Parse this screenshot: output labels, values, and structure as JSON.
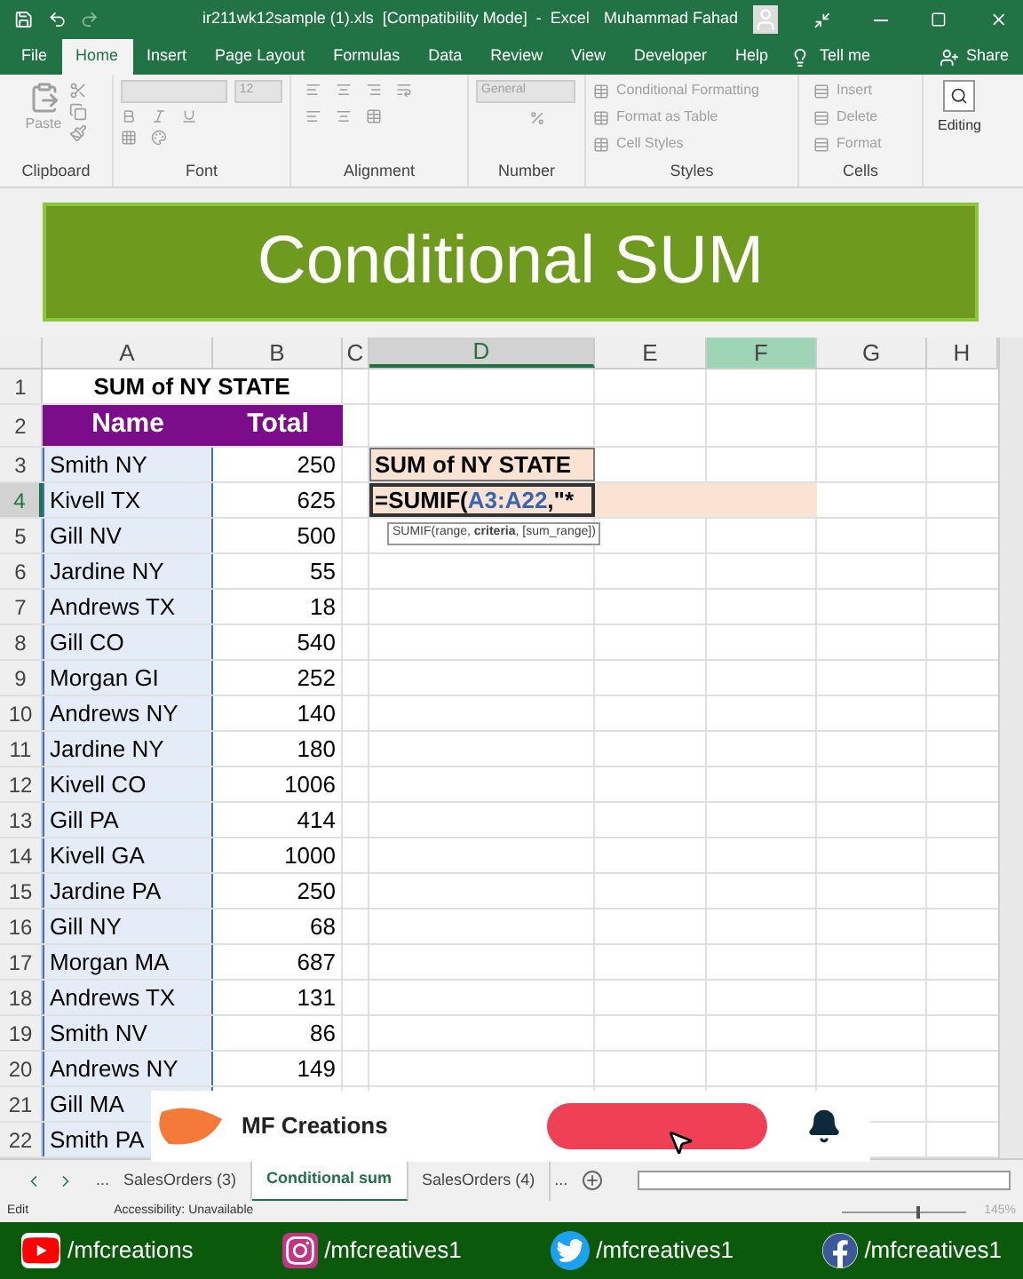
{
  "title_bar": {
    "file_title": "ir211wk12sample (1).xls  [Compatibility Mode]  -  Excel",
    "user_name": "Muhammad Fahad"
  },
  "menu_tabs": [
    {
      "label": "File",
      "selected": false
    },
    {
      "label": "Home",
      "selected": true
    },
    {
      "label": "Insert",
      "selected": false
    },
    {
      "label": "Page Layout",
      "selected": false
    },
    {
      "label": "Formulas",
      "selected": false
    },
    {
      "label": "Data",
      "selected": false
    },
    {
      "label": "Review",
      "selected": false
    },
    {
      "label": "View",
      "selected": false
    },
    {
      "label": "Developer",
      "selected": false
    },
    {
      "label": "Help",
      "selected": false
    }
  ],
  "tell_me": "Tell me",
  "share": "Share",
  "ribbon": {
    "disabled": true,
    "paste": "Paste",
    "font_size": "12",
    "number_format": "General",
    "styles": [
      "Conditional Formatting",
      "Format as Table",
      "Cell Styles"
    ],
    "cells": [
      "Insert",
      "Delete",
      "Format"
    ],
    "editing": "Editing",
    "group_labels": [
      "Clipboard",
      "Font",
      "Alignment",
      "Number",
      "Styles",
      "Cells"
    ]
  },
  "banner": {
    "title": "Conditional SUM"
  },
  "sheet": {
    "columns": [
      {
        "label": "A",
        "selected": false,
        "hovered": false
      },
      {
        "label": "B",
        "selected": false,
        "hovered": false
      },
      {
        "label": "C",
        "selected": false,
        "hovered": false
      },
      {
        "label": "D",
        "selected": true,
        "hovered": false
      },
      {
        "label": "E",
        "selected": false,
        "hovered": false
      },
      {
        "label": "F",
        "selected": false,
        "hovered": true
      },
      {
        "label": "G",
        "selected": false,
        "hovered": false
      },
      {
        "label": "H",
        "selected": false,
        "hovered": false
      }
    ],
    "title": "SUM of NY STATE",
    "headers": [
      "Name",
      "Total"
    ],
    "rows": [
      {
        "number": "1",
        "selected": false
      },
      {
        "number": "2",
        "selected": false
      },
      {
        "number": "3",
        "selected": false,
        "name": "Smith NY",
        "total": "250"
      },
      {
        "number": "4",
        "selected": true,
        "name": "Kivell TX",
        "total": "625"
      },
      {
        "number": "5",
        "selected": false,
        "name": "Gill NV",
        "total": "500"
      },
      {
        "number": "6",
        "selected": false,
        "name": "Jardine NY",
        "total": "55"
      },
      {
        "number": "7",
        "selected": false,
        "name": "Andrews TX",
        "total": "18"
      },
      {
        "number": "8",
        "selected": false,
        "name": "Gill CO",
        "total": "540"
      },
      {
        "number": "9",
        "selected": false,
        "name": "Morgan GI",
        "total": "252"
      },
      {
        "number": "10",
        "selected": false,
        "name": "Andrews NY",
        "total": "140"
      },
      {
        "number": "11",
        "selected": false,
        "name": "Jardine NY",
        "total": "180"
      },
      {
        "number": "12",
        "selected": false,
        "name": "Kivell CO",
        "total": "1006"
      },
      {
        "number": "13",
        "selected": false,
        "name": "Gill PA",
        "total": "414"
      },
      {
        "number": "14",
        "selected": false,
        "name": "Kivell GA",
        "total": "1000"
      },
      {
        "number": "15",
        "selected": false,
        "name": "Jardine PA",
        "total": "250"
      },
      {
        "number": "16",
        "selected": false,
        "name": "Gill NY",
        "total": "68"
      },
      {
        "number": "17",
        "selected": false,
        "name": "Morgan MA",
        "total": "687"
      },
      {
        "number": "18",
        "selected": false,
        "name": "Andrews TX",
        "total": "131"
      },
      {
        "number": "19",
        "selected": false,
        "name": "Smith NV",
        "total": "86"
      },
      {
        "number": "20",
        "selected": false,
        "name": "Andrews NY",
        "total": "149"
      },
      {
        "number": "21",
        "selected": false,
        "name": "Gill MA"
      },
      {
        "number": "22",
        "selected": false,
        "name": "Smith PA"
      }
    ],
    "d3": "SUM of NY STATE",
    "formula": [
      {
        "text": "=SUMIF(",
        "kind": "plain"
      },
      {
        "text": "A3:A22",
        "kind": "ref"
      },
      {
        "text": ",\"*",
        "kind": "plain"
      }
    ],
    "tooltip": "SUMIF(range, **criteria**, [sum_range])"
  },
  "overlay": {
    "brand": "MF Creations"
  },
  "sheet_tabs": {
    "more_left": "...",
    "tabs": [
      {
        "label": "SalesOrders (3)",
        "selected": false
      },
      {
        "label": "Conditional sum",
        "selected": true
      },
      {
        "label": "SalesOrders (4)",
        "selected": false
      }
    ],
    "more_right": "..."
  },
  "status_bar": {
    "mode": "Edit",
    "accessibility": "Accessibility: Unavailable",
    "zoom": "145%",
    "zoom_slider": {
      "level": 0.6
    }
  },
  "social": [
    {
      "kind": "video",
      "handle": "/mfcreations"
    },
    {
      "kind": "camera",
      "handle": "/mfcreatives1"
    },
    {
      "kind": "bird",
      "handle": "/mfcreatives1"
    },
    {
      "kind": "letter",
      "handle": "/mfcreatives1"
    }
  ]
}
